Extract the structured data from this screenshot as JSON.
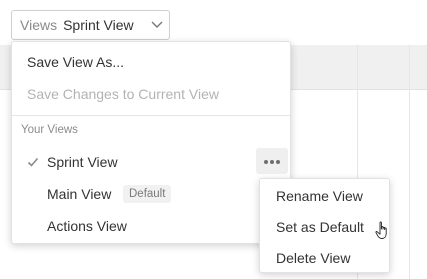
{
  "view_selector": {
    "label": "Views",
    "value": "Sprint View"
  },
  "menu": {
    "save_as": "Save View As...",
    "save_changes": "Save Changes to Current View",
    "section_label": "Your Views",
    "views": [
      {
        "name": "Sprint View",
        "selected": true,
        "badge": ""
      },
      {
        "name": "Main View",
        "selected": false,
        "badge": "Default"
      },
      {
        "name": "Actions View",
        "selected": false,
        "badge": ""
      }
    ]
  },
  "submenu": {
    "items": [
      "Rename View",
      "Set as Default",
      "Delete View"
    ]
  },
  "icons": [
    "chevron-down-icon",
    "check-icon",
    "more-horizontal-icon",
    "hand-pointer-cursor-icon"
  ],
  "colors": {
    "disabled_text": "#b3b3b3",
    "badge_bg": "#f1f1f1",
    "more_button_bg": "#efefef"
  }
}
